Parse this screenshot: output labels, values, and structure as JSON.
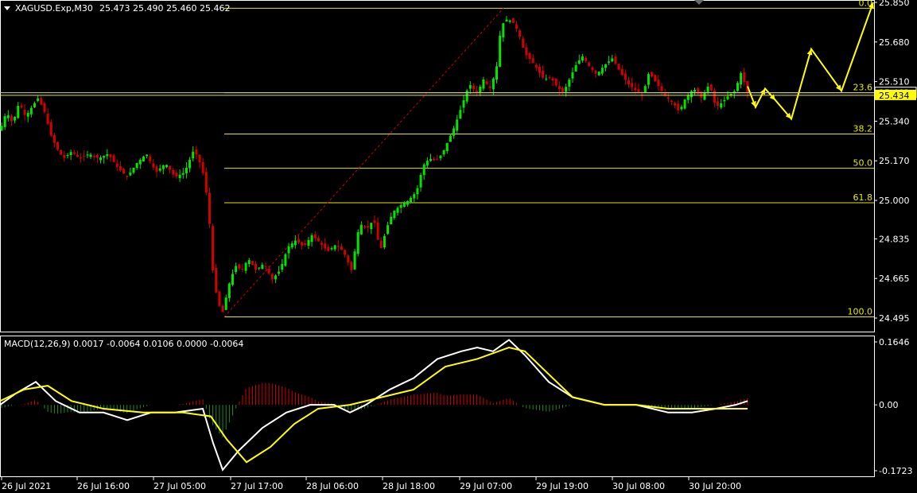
{
  "header": {
    "symbol": "XAGUSD.Exp,M30",
    "ohlc": "25.473 25.490 25.460 25.462"
  },
  "price_axis": {
    "ticks": [
      "25.850",
      "25.680",
      "25.510",
      "25.340",
      "25.170",
      "25.000",
      "24.835",
      "24.665",
      "24.495"
    ],
    "current_price": "25.462",
    "marker_price": "25.434"
  },
  "fib": {
    "levels": [
      {
        "label": "0.0",
        "price": 25.825
      },
      {
        "label": "23.6",
        "price": 25.462
      },
      {
        "label": "38.2",
        "price": 25.285
      },
      {
        "label": "50.0",
        "price": 25.138
      },
      {
        "label": "61.8",
        "price": 24.99
      },
      {
        "label": "100.0",
        "price": 24.5
      }
    ],
    "line_color": "#e6e600"
  },
  "time_axis": {
    "labels": [
      "26 Jul 2021",
      "26 Jul 16:00",
      "27 Jul 05:00",
      "27 Jul 17:00",
      "28 Jul 06:00",
      "28 Jul 18:00",
      "29 Jul 07:00",
      "29 Jul 19:00",
      "30 Jul 08:00",
      "30 Jul 20:00"
    ]
  },
  "macd": {
    "label": "MACD(12,26,9) 0.0017 -0.0064 0.0106 0.0000 -0.0064",
    "ticks": [
      "0.1646",
      "0.00",
      "-0.1723"
    ]
  },
  "colors": {
    "bull": "#00e600",
    "bear": "#d40000",
    "grid": "#ffffff",
    "yellow": "#ffff00",
    "macd_main": "#ffffff",
    "macd_signal": "#ffff00"
  },
  "chart_data": {
    "type": "candlestick",
    "title": "XAGUSD.Exp,M30",
    "ylim": [
      24.46,
      25.87
    ],
    "price_path": [
      [
        0,
        25.3
      ],
      [
        8,
        25.38
      ],
      [
        16,
        25.33
      ],
      [
        24,
        25.42
      ],
      [
        32,
        25.36
      ],
      [
        40,
        25.4
      ],
      [
        48,
        25.44
      ],
      [
        56,
        25.38
      ],
      [
        64,
        25.28
      ],
      [
        72,
        25.22
      ],
      [
        80,
        25.18
      ],
      [
        90,
        25.21
      ],
      [
        100,
        25.18
      ],
      [
        112,
        25.2
      ],
      [
        124,
        25.18
      ],
      [
        136,
        25.2
      ],
      [
        148,
        25.14
      ],
      [
        160,
        25.1
      ],
      [
        172,
        25.16
      ],
      [
        184,
        25.2
      ],
      [
        196,
        25.12
      ],
      [
        208,
        25.16
      ],
      [
        220,
        25.1
      ],
      [
        232,
        25.12
      ],
      [
        244,
        25.22
      ],
      [
        254,
        25.14
      ],
      [
        260,
        25.02
      ],
      [
        264,
        24.88
      ],
      [
        268,
        24.68
      ],
      [
        274,
        24.56
      ],
      [
        280,
        24.52
      ],
      [
        288,
        24.64
      ],
      [
        296,
        24.72
      ],
      [
        304,
        24.7
      ],
      [
        312,
        24.75
      ],
      [
        322,
        24.7
      ],
      [
        332,
        24.73
      ],
      [
        342,
        24.66
      ],
      [
        352,
        24.7
      ],
      [
        362,
        24.8
      ],
      [
        372,
        24.83
      ],
      [
        382,
        24.8
      ],
      [
        392,
        24.85
      ],
      [
        402,
        24.82
      ],
      [
        412,
        24.78
      ],
      [
        422,
        24.81
      ],
      [
        432,
        24.78
      ],
      [
        442,
        24.7
      ],
      [
        452,
        24.9
      ],
      [
        462,
        24.88
      ],
      [
        470,
        24.92
      ],
      [
        478,
        24.78
      ],
      [
        486,
        24.88
      ],
      [
        494,
        24.95
      ],
      [
        504,
        24.98
      ],
      [
        514,
        25.0
      ],
      [
        524,
        25.04
      ],
      [
        532,
        25.15
      ],
      [
        540,
        25.18
      ],
      [
        548,
        25.17
      ],
      [
        556,
        25.2
      ],
      [
        564,
        25.26
      ],
      [
        572,
        25.32
      ],
      [
        580,
        25.4
      ],
      [
        590,
        25.5
      ],
      [
        600,
        25.46
      ],
      [
        608,
        25.52
      ],
      [
        616,
        25.48
      ],
      [
        624,
        25.56
      ],
      [
        630,
        25.75
      ],
      [
        638,
        25.78
      ],
      [
        646,
        25.76
      ],
      [
        652,
        25.72
      ],
      [
        660,
        25.63
      ],
      [
        668,
        25.6
      ],
      [
        676,
        25.56
      ],
      [
        684,
        25.52
      ],
      [
        692,
        25.53
      ],
      [
        700,
        25.49
      ],
      [
        708,
        25.46
      ],
      [
        716,
        25.52
      ],
      [
        724,
        25.58
      ],
      [
        732,
        25.62
      ],
      [
        740,
        25.58
      ],
      [
        750,
        25.54
      ],
      [
        760,
        25.58
      ],
      [
        770,
        25.61
      ],
      [
        780,
        25.55
      ],
      [
        790,
        25.5
      ],
      [
        800,
        25.47
      ],
      [
        808,
        25.45
      ],
      [
        816,
        25.55
      ],
      [
        826,
        25.5
      ],
      [
        836,
        25.45
      ],
      [
        846,
        25.42
      ],
      [
        854,
        25.38
      ],
      [
        862,
        25.44
      ],
      [
        872,
        25.48
      ],
      [
        882,
        25.44
      ],
      [
        892,
        25.5
      ],
      [
        900,
        25.4
      ],
      [
        908,
        25.42
      ],
      [
        916,
        25.45
      ],
      [
        924,
        25.47
      ],
      [
        932,
        25.55
      ],
      [
        940,
        25.46
      ]
    ],
    "macd_main": [
      [
        0,
        0.0
      ],
      [
        20,
        0.03
      ],
      [
        45,
        0.06
      ],
      [
        70,
        0.01
      ],
      [
        100,
        -0.02
      ],
      [
        130,
        -0.02
      ],
      [
        160,
        -0.04
      ],
      [
        190,
        -0.02
      ],
      [
        220,
        -0.02
      ],
      [
        255,
        -0.01
      ],
      [
        268,
        -0.1
      ],
      [
        280,
        -0.17
      ],
      [
        300,
        -0.12
      ],
      [
        330,
        -0.06
      ],
      [
        360,
        -0.02
      ],
      [
        390,
        0.0
      ],
      [
        420,
        0.0
      ],
      [
        440,
        -0.02
      ],
      [
        460,
        0.0
      ],
      [
        490,
        0.04
      ],
      [
        520,
        0.07
      ],
      [
        550,
        0.12
      ],
      [
        580,
        0.14
      ],
      [
        600,
        0.15
      ],
      [
        620,
        0.14
      ],
      [
        640,
        0.17
      ],
      [
        660,
        0.13
      ],
      [
        690,
        0.06
      ],
      [
        720,
        0.02
      ],
      [
        760,
        0.0
      ],
      [
        800,
        0.0
      ],
      [
        840,
        -0.02
      ],
      [
        870,
        -0.02
      ],
      [
        900,
        -0.01
      ],
      [
        925,
        0.0
      ],
      [
        940,
        0.01
      ]
    ],
    "macd_signal": [
      [
        0,
        0.01
      ],
      [
        30,
        0.04
      ],
      [
        60,
        0.05
      ],
      [
        90,
        0.01
      ],
      [
        130,
        -0.01
      ],
      [
        180,
        -0.02
      ],
      [
        230,
        -0.02
      ],
      [
        265,
        -0.03
      ],
      [
        285,
        -0.09
      ],
      [
        310,
        -0.15
      ],
      [
        340,
        -0.11
      ],
      [
        370,
        -0.05
      ],
      [
        400,
        -0.01
      ],
      [
        440,
        0.0
      ],
      [
        480,
        0.02
      ],
      [
        520,
        0.04
      ],
      [
        560,
        0.1
      ],
      [
        600,
        0.12
      ],
      [
        640,
        0.15
      ],
      [
        660,
        0.14
      ],
      [
        690,
        0.08
      ],
      [
        720,
        0.02
      ],
      [
        760,
        0.0
      ],
      [
        800,
        0.0
      ],
      [
        840,
        -0.01
      ],
      [
        880,
        -0.01
      ],
      [
        920,
        -0.01
      ],
      [
        940,
        -0.01
      ]
    ],
    "forecast_path": [
      [
        940,
        25.49
      ],
      [
        950,
        25.4
      ],
      [
        962,
        25.48
      ],
      [
        975,
        25.43
      ],
      [
        995,
        25.35
      ],
      [
        1020,
        25.65
      ],
      [
        1058,
        25.47
      ],
      [
        1098,
        25.85
      ]
    ]
  }
}
